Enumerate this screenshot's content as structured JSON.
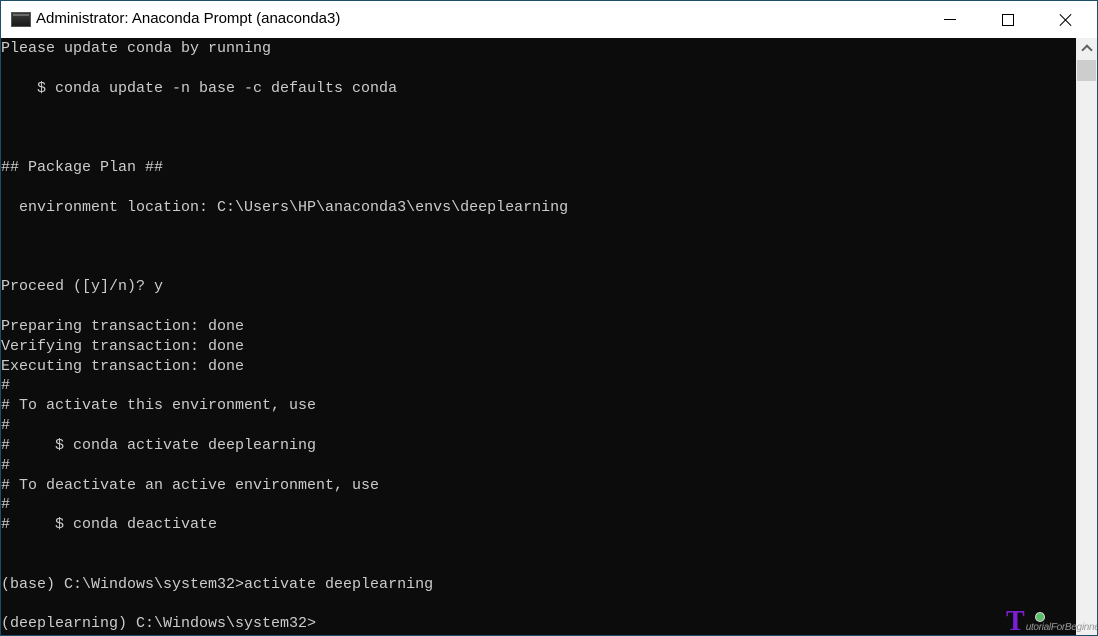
{
  "window": {
    "title": "Administrator: Anaconda Prompt (anaconda3)",
    "icon": "console-icon",
    "controls": {
      "minimize": "minimize-icon",
      "maximize": "maximize-icon",
      "close": "close-icon"
    }
  },
  "console": {
    "lines": [
      "Please update conda by running",
      "",
      "    $ conda update -n base -c defaults conda",
      "",
      "",
      "",
      "## Package Plan ##",
      "",
      "  environment location: C:\\Users\\HP\\anaconda3\\envs\\deeplearning",
      "",
      "",
      "",
      "Proceed ([y]/n)? y",
      "",
      "Preparing transaction: done",
      "Verifying transaction: done",
      "Executing transaction: done",
      "#",
      "# To activate this environment, use",
      "#",
      "#     $ conda activate deeplearning",
      "#",
      "# To deactivate an active environment, use",
      "#",
      "#     $ conda deactivate",
      "",
      "",
      "(base) C:\\Windows\\system32>activate deeplearning",
      "",
      "(deeplearning) C:\\Windows\\system32>"
    ]
  },
  "scrollbar": {
    "up_arrow": "chevron-up-icon"
  },
  "watermark": {
    "letter": "T",
    "text": "utorialForBeginner"
  },
  "colors": {
    "console_bg": "#0c0c0c",
    "console_fg": "#cccccc",
    "titlebar_bg": "#ffffff",
    "window_border": "#1f4e6b",
    "watermark_accent": "#7a1fd6"
  }
}
